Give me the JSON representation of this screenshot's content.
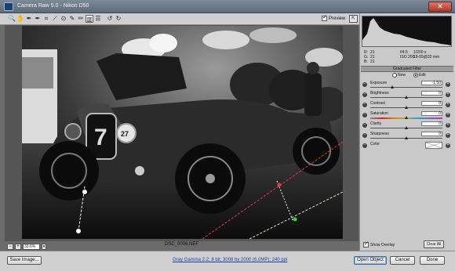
{
  "window": {
    "title": "Camera Raw 5.0  -  Nikon D50",
    "close_glyph": "✕"
  },
  "toolbar": {
    "tools": [
      {
        "name": "zoom-tool-icon",
        "glyph": "🔍"
      },
      {
        "name": "hand-tool-icon",
        "glyph": "✋"
      },
      {
        "name": "white-balance-tool-icon",
        "glyph": "✒"
      },
      {
        "name": "color-sampler-tool-icon",
        "glyph": "✒"
      },
      {
        "name": "crop-tool-icon",
        "glyph": "⌗"
      },
      {
        "name": "straighten-tool-icon",
        "glyph": "⟋"
      },
      {
        "name": "red-eye-tool-icon",
        "glyph": "⊙"
      },
      {
        "name": "spot-removal-tool-icon",
        "glyph": "✎"
      },
      {
        "name": "adjustment-brush-icon",
        "glyph": "✏"
      },
      {
        "name": "graduated-filter-icon",
        "glyph": "▥"
      },
      {
        "name": "preferences-icon",
        "glyph": "☰"
      },
      {
        "name": "rotate-ccw-icon",
        "glyph": "↺"
      },
      {
        "name": "rotate-cw-icon",
        "glyph": "↻"
      }
    ],
    "preview_label": "Preview",
    "preview_checked": true
  },
  "image": {
    "filename": "DSC_0006.NEF",
    "zoom_level": "33.6%"
  },
  "readout": {
    "rgb": [
      {
        "ch": "R:",
        "val": "21"
      },
      {
        "ch": "G:",
        "val": "21"
      },
      {
        "ch": "B:",
        "val": "21"
      }
    ],
    "exif": [
      {
        "a": "f/4.5",
        "b": "1/200 s"
      },
      {
        "a": "ISO 200",
        "b": "18-55@32 mm"
      }
    ]
  },
  "filter_panel": {
    "header": "Graduated Filter",
    "mode_new": "New",
    "mode_edit": "Edit",
    "selected_mode": "Edit",
    "sliders": [
      {
        "label": "Exposure",
        "value": "-1.50",
        "position": 0.3
      },
      {
        "label": "Brightness",
        "value": "0",
        "position": 0.5
      },
      {
        "label": "Contrast",
        "value": "0",
        "position": 0.5
      },
      {
        "label": "Saturation",
        "value": "0",
        "position": 0.5
      },
      {
        "label": "Clarity",
        "value": "0",
        "position": 0.5
      },
      {
        "label": "Sharpness",
        "value": "0",
        "position": 0.5
      }
    ],
    "color_label": "Color",
    "show_overlay_label": "Show Overlay",
    "show_overlay_checked": true,
    "clear_all_label": "Clear All"
  },
  "bottom": {
    "save_image_label": "Save Image...",
    "workflow_options": "Gray Gamma 2.2; 8 bit; 3008 by 2000 (6.0MP); 240 ppi",
    "open_object_label": "Open Object",
    "cancel_label": "Cancel",
    "done_label": "Done"
  },
  "colors": {
    "accent": "#3a6ea5",
    "overlay_red": "#e43b3b",
    "overlay_green": "#3bd43b",
    "overlay_white": "#ffffff"
  }
}
